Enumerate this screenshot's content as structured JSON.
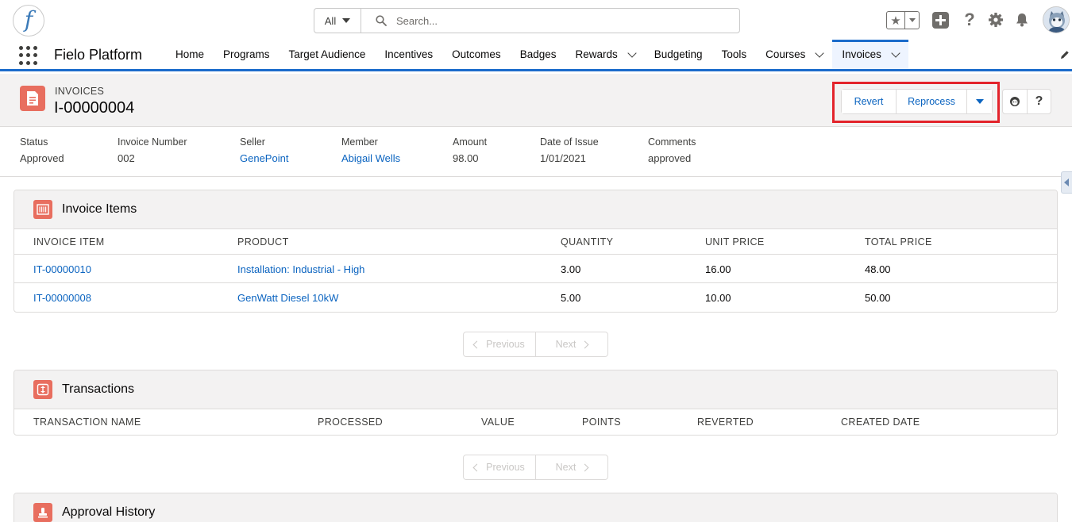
{
  "header": {
    "logo_letter": "f",
    "search": {
      "scope": "All",
      "placeholder": "Search..."
    }
  },
  "nav": {
    "app_name": "Fielo Platform",
    "items": [
      {
        "label": "Home",
        "has_menu": false
      },
      {
        "label": "Programs",
        "has_menu": false
      },
      {
        "label": "Target Audience",
        "has_menu": false
      },
      {
        "label": "Incentives",
        "has_menu": false
      },
      {
        "label": "Outcomes",
        "has_menu": false
      },
      {
        "label": "Badges",
        "has_menu": false
      },
      {
        "label": "Rewards",
        "has_menu": true
      },
      {
        "label": "Budgeting",
        "has_menu": false
      },
      {
        "label": "Tools",
        "has_menu": false
      },
      {
        "label": "Courses",
        "has_menu": true
      },
      {
        "label": "Invoices",
        "has_menu": true,
        "active": true
      }
    ]
  },
  "record": {
    "object_type": "INVOICES",
    "title": "I-00000004",
    "actions": {
      "revert": "Revert",
      "reprocess": "Reprocess"
    }
  },
  "highlights": [
    {
      "label": "Status",
      "value": "Approved",
      "link": false
    },
    {
      "label": "Invoice Number",
      "value": "002",
      "link": false
    },
    {
      "label": "Seller",
      "value": "GenePoint",
      "link": true
    },
    {
      "label": "Member",
      "value": "Abigail Wells",
      "link": true
    },
    {
      "label": "Amount",
      "value": "98.00",
      "link": false
    },
    {
      "label": "Date of Issue",
      "value": "1/01/2021",
      "link": false
    },
    {
      "label": "Comments",
      "value": "approved",
      "link": false
    }
  ],
  "invoice_items": {
    "title": "Invoice Items",
    "columns": [
      "INVOICE ITEM",
      "PRODUCT",
      "QUANTITY",
      "UNIT PRICE",
      "TOTAL PRICE"
    ],
    "rows": [
      [
        "IT-00000010",
        "Installation: Industrial - High",
        "3.00",
        "16.00",
        "48.00"
      ],
      [
        "IT-00000008",
        "GenWatt Diesel 10kW",
        "5.00",
        "10.00",
        "50.00"
      ]
    ]
  },
  "transactions": {
    "title": "Transactions",
    "columns": [
      "TRANSACTION NAME",
      "PROCESSED",
      "VALUE",
      "POINTS",
      "REVERTED",
      "CREATED DATE"
    ]
  },
  "approval_history": {
    "title": "Approval History"
  },
  "pager": {
    "previous": "Previous",
    "next": "Next"
  },
  "colors": {
    "brand": "#1b6bcb",
    "link": "#0b64c0",
    "record_icon": "#e86e5f",
    "highlight": "#e3232b"
  }
}
